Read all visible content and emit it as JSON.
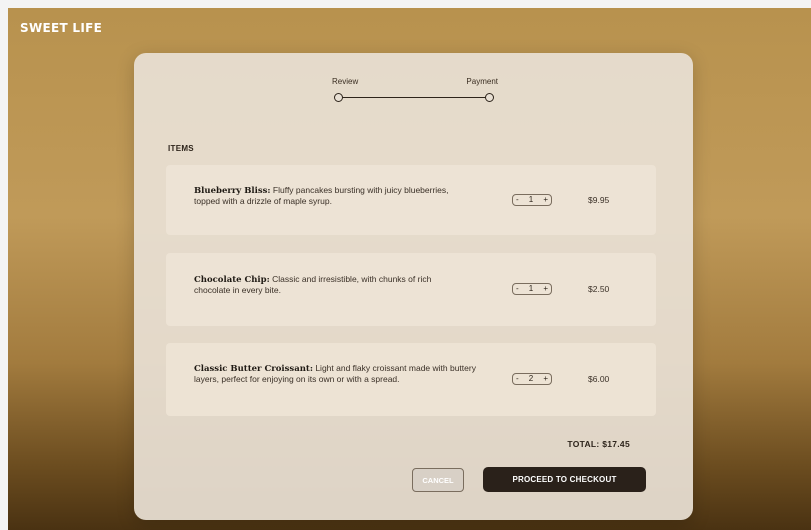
{
  "brand": "SWEET LIFE",
  "steps": {
    "review": "Review",
    "payment": "Payment"
  },
  "items_heading": "ITEMS",
  "items": [
    {
      "name": "Blueberry Bliss:",
      "desc": " Fluffy pancakes bursting with juicy blueberries, topped with a drizzle of maple syrup.",
      "qty": "1",
      "price": "$9.95"
    },
    {
      "name": "Chocolate Chip:",
      "desc": " Classic and irresistible, with chunks of rich chocolate in every bite.",
      "qty": "1",
      "price": "$2.50"
    },
    {
      "name": "Classic Butter Croissant:",
      "desc": " Light and flaky croissant made with buttery layers, perfect for enjoying on its own or with a spread.",
      "qty": "2",
      "price": "$6.00"
    }
  ],
  "stepper": {
    "minus": "-",
    "plus": "+"
  },
  "total_label": "TOTAL: $17.45",
  "buttons": {
    "cancel": "CANCEL",
    "checkout": "PROCEED TO CHECKOUT"
  },
  "colors": {
    "accent": "#2a211a",
    "background_top": "#b8924e",
    "background_bottom": "#4a3212"
  }
}
